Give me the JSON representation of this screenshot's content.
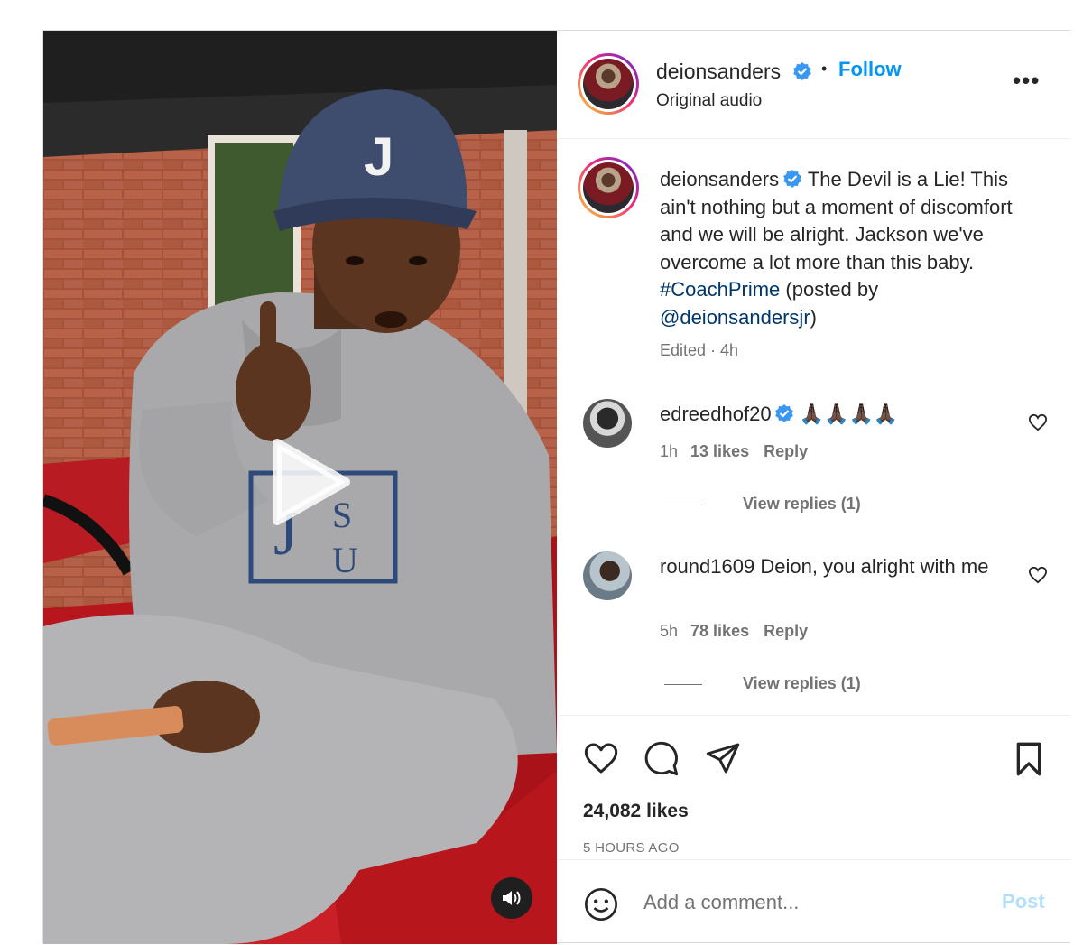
{
  "post": {
    "author": "deionsanders",
    "follow_label": "Follow",
    "separator": "•",
    "audio": "Original audio",
    "more_label": "•••",
    "caption": {
      "username": "deionsanders",
      "text_before": " The Devil is a Lie! This ain't nothing but a moment of discomfort and we will be alright. Jackson we've overcome a lot more than this baby. ",
      "hashtag": "#CoachPrime",
      "text_middle": " (posted by ",
      "mention": "@deionsandersjr",
      "text_after": ")",
      "meta": "Edited · 4h"
    },
    "comments": [
      {
        "username": "edreedhof20",
        "verified": true,
        "text": " 🙏🏿🙏🏿🙏🏿🙏🏿",
        "time": "1h",
        "likes": "13 likes",
        "reply_label": "Reply",
        "view_replies": "View replies (1)"
      },
      {
        "username": "round1609",
        "verified": false,
        "text": " Deion, you alright with me",
        "time": "5h",
        "likes": "78 likes",
        "reply_label": "Reply",
        "view_replies": "View replies (1)"
      }
    ],
    "likes": "24,082 likes",
    "time_ago": "5 HOURS AGO",
    "comment_placeholder": "Add a comment...",
    "post_label": "Post"
  },
  "icons": {
    "verified": "verified-badge-icon",
    "like": "heart-icon",
    "comment": "comment-bubble-icon",
    "share": "paper-plane-icon",
    "save": "bookmark-icon",
    "emoji": "smiley-icon",
    "play": "play-icon",
    "sound": "speaker-icon"
  },
  "colors": {
    "follow_blue": "#0095f6",
    "link_blue": "#00376b",
    "verified_blue": "#3897f0",
    "muted": "#737373",
    "post_disabled": "#b2dffc"
  }
}
